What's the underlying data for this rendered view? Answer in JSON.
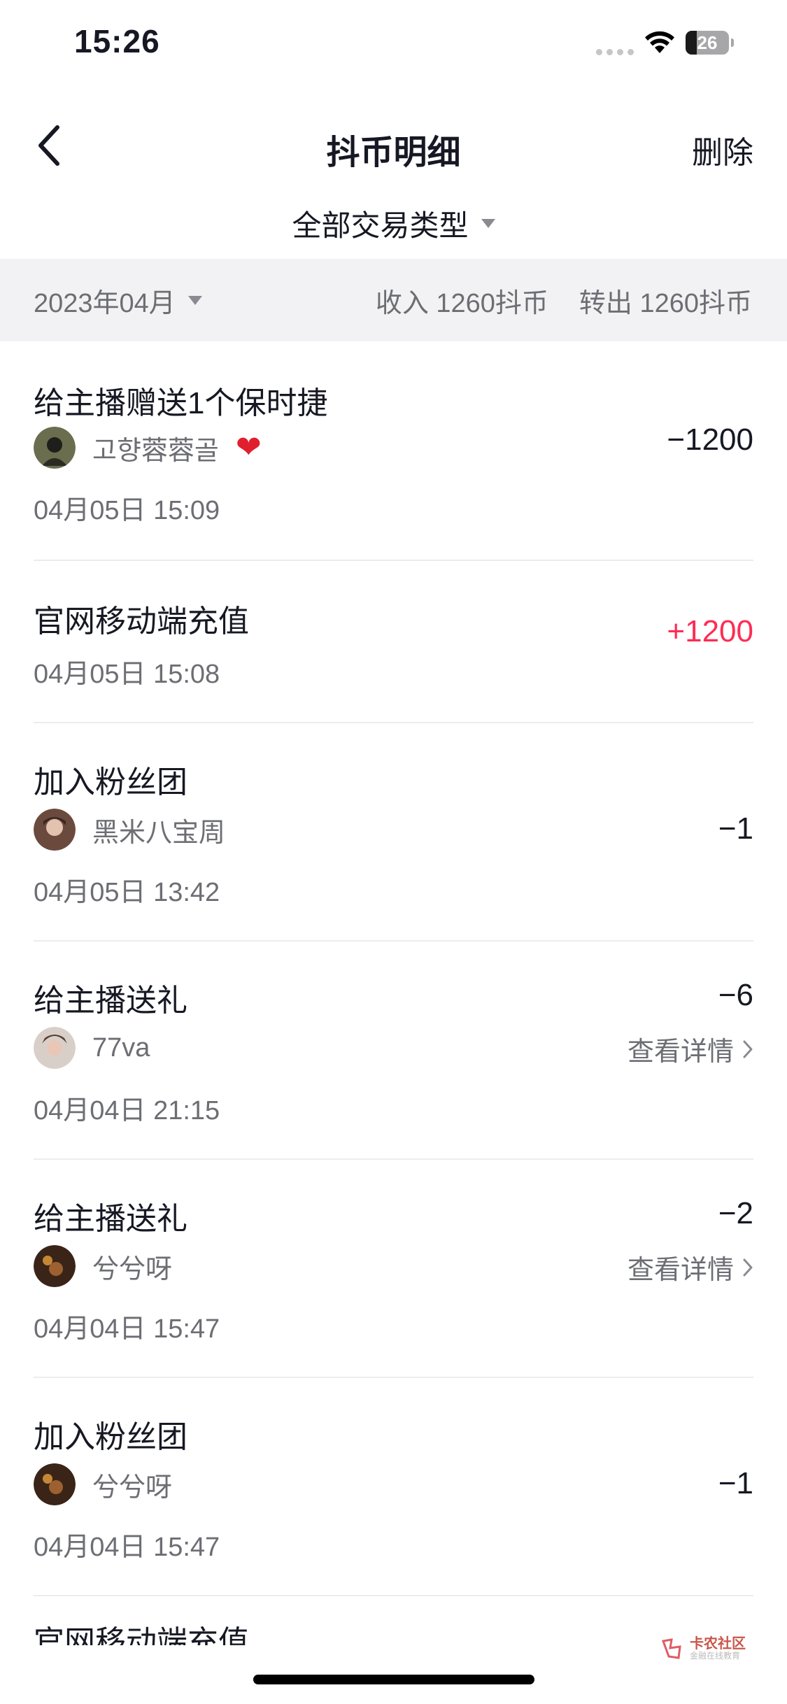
{
  "status_bar": {
    "time": "15:26",
    "battery": "26",
    "battery_level": 0.26
  },
  "nav": {
    "title": "抖币明细",
    "delete_label": "删除"
  },
  "filter": {
    "label": "全部交易类型"
  },
  "summary": {
    "month": "2023年04月",
    "income": "收入 1260抖币",
    "outgo": "转出 1260抖币"
  },
  "transactions": [
    {
      "title": "给主播赠送1个保时捷",
      "user": "고향蓉蓉골",
      "time": "04月05日 15:09",
      "amount": "−1200",
      "avatar_color": "#6a6e4f"
    },
    {
      "title": "官网移动端充值",
      "time": "04月05日 15:08",
      "amount": "+1200"
    },
    {
      "title": "加入粉丝团",
      "user": "黑米八宝周",
      "time": "04月05日 13:42",
      "amount": "−1",
      "avatar_color": "#6b4a3e"
    },
    {
      "title": "给主播送礼",
      "user": "77va",
      "time": "04月04日 21:15",
      "amount": "−6",
      "detail": "查看详情",
      "avatar_color": "#8a6b5c"
    },
    {
      "title": "给主播送礼",
      "user": "兮兮呀",
      "time": "04月04日 15:47",
      "amount": "−2",
      "detail": "查看详情",
      "avatar_color": "#3a2418"
    },
    {
      "title": "加入粉丝团",
      "user": "兮兮呀",
      "time": "04月04日 15:47",
      "amount": "−1",
      "avatar_color": "#3a2418"
    }
  ],
  "partial_row": {
    "title": "官网移动端充值"
  },
  "watermark": {
    "text": "卡农社区",
    "sub": "金融在线教育"
  },
  "colors": {
    "positive": "#fe2c55",
    "text": "#161823",
    "secondary": "#6d6e74",
    "band": "#f2f2f4"
  }
}
